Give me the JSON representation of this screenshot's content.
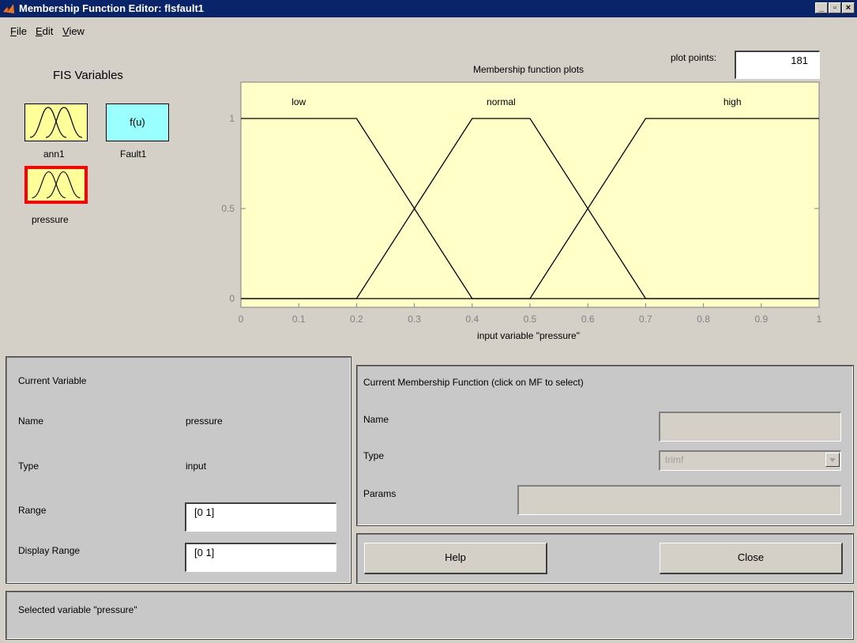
{
  "window": {
    "title": "Membership Function Editor: flsfault1",
    "minimize_glyph": "_",
    "maximize_glyph": "▫",
    "close_glyph": "×"
  },
  "menu": {
    "file": {
      "mnemonic": "F",
      "rest": "ile"
    },
    "edit": {
      "mnemonic": "E",
      "rest": "dit"
    },
    "view": {
      "mnemonic": "V",
      "rest": "iew"
    }
  },
  "fis_variables": {
    "heading": "FIS Variables",
    "items": [
      {
        "label": "ann1",
        "kind": "input",
        "color": "#ffff99",
        "selected": false
      },
      {
        "label": "Fault1",
        "kind": "output",
        "text": "f(u)",
        "color": "#99ffff",
        "selected": false
      },
      {
        "label": "pressure",
        "kind": "input",
        "color": "#ffff99",
        "selected": true
      }
    ]
  },
  "plot_points": {
    "label": "plot points:",
    "value": "181"
  },
  "chart_data": {
    "type": "line",
    "title": "Membership function plots",
    "xlabel": "input variable \"pressure\"",
    "ylabel": "",
    "xlim": [
      0,
      1
    ],
    "ylim": [
      0,
      1
    ],
    "x_ticks": [
      0,
      0.1,
      0.2,
      0.3,
      0.4,
      0.5,
      0.6,
      0.7,
      0.8,
      0.9,
      1
    ],
    "y_ticks": [
      0,
      0.5,
      1
    ],
    "background": "#ffffc8",
    "series": [
      {
        "name": "low",
        "x": [
          0,
          0.2,
          0.4,
          1
        ],
        "y": [
          1,
          1,
          0,
          0
        ]
      },
      {
        "name": "normal",
        "x": [
          0,
          0.2,
          0.4,
          0.5,
          0.7,
          1
        ],
        "y": [
          0,
          0,
          1,
          1,
          0,
          0
        ]
      },
      {
        "name": "high",
        "x": [
          0,
          0.5,
          0.7,
          1
        ],
        "y": [
          0,
          0,
          1,
          1
        ]
      }
    ]
  },
  "current_variable": {
    "heading": "Current Variable",
    "name_label": "Name",
    "name_value": "pressure",
    "type_label": "Type",
    "type_value": "input",
    "range_label": "Range",
    "range_value": "[0 1]",
    "display_range_label": "Display Range",
    "display_range_value": "[0 1]"
  },
  "current_mf": {
    "heading": "Current Membership Function (click on MF to select)",
    "name_label": "Name",
    "name_value": "",
    "type_label": "Type",
    "type_value": "trimf",
    "params_label": "Params",
    "params_value": ""
  },
  "buttons": {
    "help": "Help",
    "close": "Close"
  },
  "status": "Selected variable \"pressure\""
}
